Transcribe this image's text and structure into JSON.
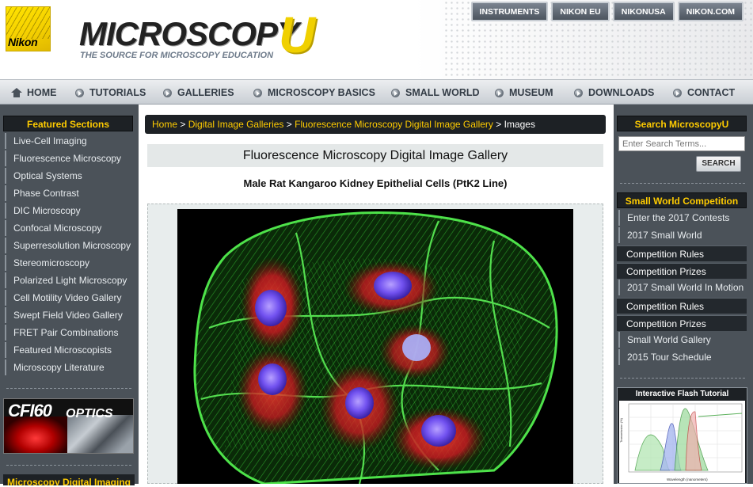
{
  "header": {
    "nikon_logo_text": "Nikon",
    "site_logo_main": "MICROSCOPY",
    "site_logo_accent": "U",
    "tagline": "THE SOURCE FOR MICROSCOPY EDUCATION",
    "top_links": [
      "INSTRUMENTS",
      "NIKON EU",
      "NIKONUSA",
      "NIKON.COM"
    ]
  },
  "nav": {
    "items": [
      "HOME",
      "TUTORIALS",
      "GALLERIES",
      "MICROSCOPY BASICS",
      "SMALL WORLD",
      "MUSEUM",
      "DOWNLOADS",
      "CONTACT"
    ]
  },
  "left_sidebar": {
    "title": "Featured Sections",
    "items": [
      "Live-Cell Imaging",
      "Fluorescence Microscopy",
      "Optical Systems",
      "Phase Contrast",
      "DIC Microscopy",
      "Confocal Microscopy",
      "Superresolution Microscopy",
      "Stereomicroscopy",
      "Polarized Light Microscopy",
      "Cell Motility Video Gallery",
      "Swept Field Video Gallery",
      "FRET Pair Combinations",
      "Featured Microscopists",
      "Microscopy Literature"
    ],
    "ad_text_1": "CFI60",
    "ad_text_2": "OPTICS",
    "bottom_title": "Microscopy Digital Imaging"
  },
  "breadcrumb": {
    "links": [
      "Home",
      "Digital Image Galleries",
      "Fluorescence Microscopy Digital Image Gallery"
    ],
    "separator": ">",
    "current": "Images"
  },
  "main": {
    "gallery_title": "Fluorescence Microscopy Digital Image Gallery",
    "subtitle": "Male Rat Kangaroo Kidney Epithelial Cells (PtK2 Line)"
  },
  "right_sidebar": {
    "search_title": "Search MicroscopyU",
    "search_placeholder": "Enter Search Terms...",
    "search_button": "SEARCH",
    "competition_title": "Small World Competition",
    "items": [
      {
        "label": "Enter the 2017 Contests",
        "kind": "link"
      },
      {
        "label": "2017 Small World",
        "kind": "link"
      },
      {
        "label": "Competition Rules",
        "kind": "sub"
      },
      {
        "label": "Competition Prizes",
        "kind": "sub"
      },
      {
        "label": "2017 Small World In Motion",
        "kind": "link"
      },
      {
        "label": "Competition Rules",
        "kind": "sub"
      },
      {
        "label": "Competition Prizes",
        "kind": "sub"
      },
      {
        "label": "Small World Gallery",
        "kind": "link"
      },
      {
        "label": "2015 Tour Schedule",
        "kind": "link"
      }
    ],
    "flash_title": "Interactive Flash Tutorial"
  },
  "colors": {
    "accent_yellow": "#ffcc00",
    "sidebar_bg": "#4b5259",
    "panel_dark": "#1d2125",
    "actin_green": "#39d63a",
    "mito_red": "#d8202a",
    "nucleus_blue": "#6a4ae8"
  }
}
